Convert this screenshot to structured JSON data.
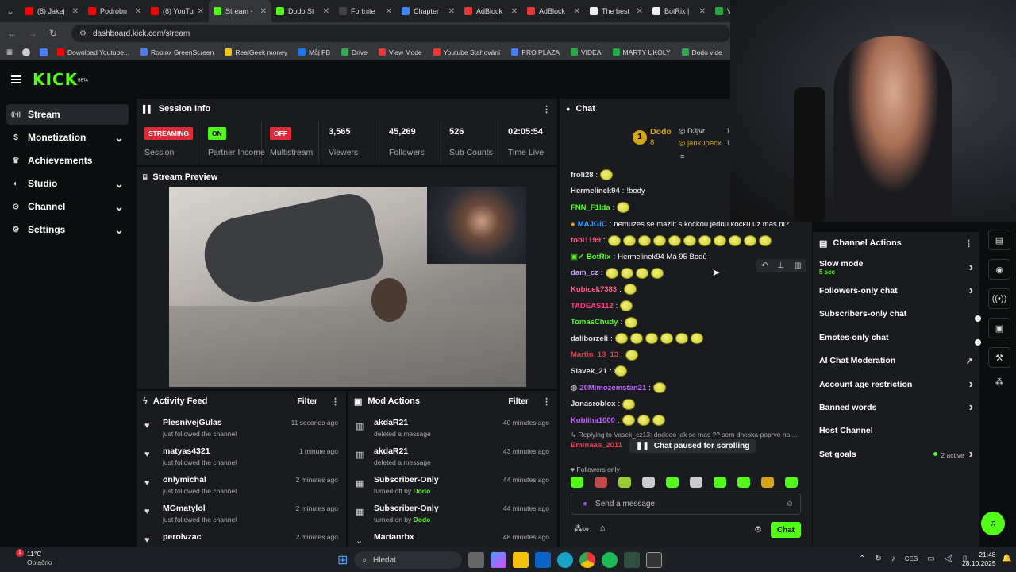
{
  "browser": {
    "tabs": [
      {
        "title": "(8) Jakej",
        "color": "#ff0000",
        "active": false
      },
      {
        "title": "Podrobn",
        "color": "#ff0000",
        "active": false
      },
      {
        "title": "(6) YouTu",
        "color": "#ff0000",
        "active": false
      },
      {
        "title": "Stream -",
        "color": "#53fc18",
        "active": true
      },
      {
        "title": "Dodo St",
        "color": "#53fc18",
        "active": false
      },
      {
        "title": "Fortnite",
        "color": "#444444",
        "active": false
      },
      {
        "title": "Chapter",
        "color": "#4285f4",
        "active": false
      },
      {
        "title": "AdBlock",
        "color": "#e53935",
        "active": false
      },
      {
        "title": "AdBlock",
        "color": "#e53935",
        "active": false
      },
      {
        "title": "The best",
        "color": "#eeeeee",
        "active": false
      },
      {
        "title": "BotRix |",
        "color": "#eeeeee",
        "active": false
      },
      {
        "title": "V",
        "color": "#22aa44",
        "active": false
      }
    ],
    "url": "dashboard.kick.com/stream",
    "bookmarks": [
      {
        "label": "Download Youtube...",
        "color": "#ff0000"
      },
      {
        "label": "Roblox GreenScreen",
        "color": "#4a7cf7"
      },
      {
        "label": "RealGeek money",
        "color": "#f4c20d"
      },
      {
        "label": "Můj FB",
        "color": "#1877f2"
      },
      {
        "label": "Drive",
        "color": "#34a853"
      },
      {
        "label": "View Mode",
        "color": "#e53935"
      },
      {
        "label": "Youtube Stahování",
        "color": "#e53935"
      },
      {
        "label": "PRO PLAZA",
        "color": "#4a7cf7"
      },
      {
        "label": "VIDEA",
        "color": "#22aa44"
      },
      {
        "label": "MARTY UKOLY",
        "color": "#22aa44"
      },
      {
        "label": "Dodo vide",
        "color": "#34a853"
      }
    ]
  },
  "kick": {
    "logo": "KICK",
    "logo_sup": "BETA",
    "sidebar": [
      {
        "label": "Stream",
        "icon": "stream-icon",
        "active": true,
        "chevron": false
      },
      {
        "label": "Monetization",
        "icon": "dollar-icon",
        "active": false,
        "chevron": true
      },
      {
        "label": "Achievements",
        "icon": "trophy-icon",
        "active": false,
        "chevron": false
      },
      {
        "label": "Studio",
        "icon": "studio-icon",
        "active": false,
        "chevron": true
      },
      {
        "label": "Channel",
        "icon": "channel-icon",
        "active": false,
        "chevron": true
      },
      {
        "label": "Settings",
        "icon": "gear-icon",
        "active": false,
        "chevron": true
      }
    ],
    "session": {
      "title": "Session Info",
      "streaming": {
        "badge": "STREAMING",
        "label": "Session"
      },
      "partner": {
        "badge": "ON",
        "label": "Partner Income"
      },
      "multistream": {
        "badge": "OFF",
        "label": "Multistream"
      },
      "viewers": {
        "value": "3,565",
        "label": "Viewers"
      },
      "followers": {
        "value": "45,269",
        "label": "Followers"
      },
      "subs": {
        "value": "526",
        "label": "Sub Counts"
      },
      "time": {
        "value": "02:05:54",
        "label": "Time Live"
      }
    },
    "preview_title": "Stream Preview",
    "activity": {
      "title": "Activity Feed",
      "filter": "Filter",
      "rows": [
        {
          "name": "PlesnivejGulas",
          "sub": "just followed the channel",
          "time": "11 seconds ago"
        },
        {
          "name": "matyas4321",
          "sub": "just followed the channel",
          "time": "1 minute ago"
        },
        {
          "name": "onlymichal",
          "sub": "just followed the channel",
          "time": "2 minutes ago"
        },
        {
          "name": "MGmatylol",
          "sub": "just followed the channel",
          "time": "2 minutes ago"
        },
        {
          "name": "perolvzac",
          "sub": "",
          "time": "2 minutes ago"
        }
      ]
    },
    "mod": {
      "title": "Mod Actions",
      "filter": "Filter",
      "rows": [
        {
          "name": "akdaR21",
          "sub": "deleted a message",
          "by": "",
          "time": "40 minutes ago",
          "icon": "trash-icon"
        },
        {
          "name": "akdaR21",
          "sub": "deleted a message",
          "by": "",
          "time": "43 minutes ago",
          "icon": "trash-icon"
        },
        {
          "name": "Subscriber-Only",
          "sub": "turned off by ",
          "by": "Dodo",
          "time": "44 minutes ago",
          "icon": "gift-icon"
        },
        {
          "name": "Subscriber-Only",
          "sub": "turned on by ",
          "by": "Dodo",
          "time": "44 minutes ago",
          "icon": "gift-icon"
        },
        {
          "name": "Martanrbx",
          "sub": "",
          "by": "",
          "time": "48 minutes ago",
          "icon": "chevron-down-icon"
        }
      ]
    },
    "chat": {
      "title": "Chat",
      "pinned": {
        "rank": "1",
        "name": "Dodo",
        "count": "8",
        "u1": "D3jvr",
        "u2": "jankupecx",
        "n1": "1",
        "n2": "1"
      },
      "messages": [
        {
          "user": "froli28",
          "color": "#e0e0e0",
          "text": "",
          "emotes": 1
        },
        {
          "user": "Hermelinek94",
          "color": "#e0e0e0",
          "text": "!body",
          "emotes": 0
        },
        {
          "user": "FNN_F1lda",
          "color": "#53fc18",
          "text": "",
          "emotes": 1
        },
        {
          "user": "MAJGIC",
          "color": "#4a9cff",
          "text": "nemuzes se mazlit s kockou jednu kocku uz mas ni?",
          "emotes": 0
        },
        {
          "user": "tobi1199",
          "color": "#ff5c8a",
          "text": "",
          "emotes": 11
        },
        {
          "user": "BotRix",
          "color": "#53fc18",
          "text": "Hermelinek94 Má 95 Bodů",
          "emotes": 0
        },
        {
          "user": "dam_cz",
          "color": "#c8a7ff",
          "text": "",
          "emotes": 4
        },
        {
          "user": "Kubicek7383",
          "color": "#ff5c8a",
          "text": "",
          "emotes": 1
        },
        {
          "user": "TADEAS112",
          "color": "#ff3c7a",
          "text": "",
          "emotes": 1
        },
        {
          "user": "TomasChudy",
          "color": "#53fc18",
          "text": "",
          "emotes": 1
        },
        {
          "user": "daliborzeli",
          "color": "#e0e0e0",
          "text": "",
          "emotes": 6
        },
        {
          "user": "Martin_13_13",
          "color": "#e0404a",
          "text": "",
          "emotes": 1
        },
        {
          "user": "Slavek_21",
          "color": "#e0e0e0",
          "text": "",
          "emotes": 1
        },
        {
          "user": "20Mimozemstan21",
          "color": "#c060ff",
          "text": "",
          "emotes": 1
        },
        {
          "user": "Jonasroblox",
          "color": "#e0e0e0",
          "text": "",
          "emotes": 1
        },
        {
          "user": "Kobliha1000",
          "color": "#c060ff",
          "text": "",
          "emotes": 3
        }
      ],
      "reply_text": "Replying to Vasek_cz13: dodooo jak se mas ?? sem dneska poprvé na ...",
      "reply_user": "Eminaaa_2011",
      "paused": "Chat paused for scrolling",
      "followers_only": "Followers only",
      "input_placeholder": "Send a message",
      "send_label": "Chat"
    },
    "channel_actions": {
      "title": "Channel Actions",
      "rows": [
        {
          "label": "Slow mode",
          "sub": "5 sec",
          "right": "chevron"
        },
        {
          "label": "Followers-only chat",
          "sub": "",
          "right": "chevron"
        },
        {
          "label": "Subscribers-only chat",
          "sub": "",
          "right": "toggle"
        },
        {
          "label": "Emotes-only chat",
          "sub": "",
          "right": "toggle"
        },
        {
          "label": "AI Chat Moderation",
          "sub": "",
          "right": "external"
        },
        {
          "label": "Account age restriction",
          "sub": "",
          "right": "chevron"
        },
        {
          "label": "Banned words",
          "sub": "",
          "right": "chevron"
        },
        {
          "label": "Host Channel",
          "sub": "",
          "right": ""
        },
        {
          "label": "Set goals",
          "sub": "2 active",
          "right": "chevron"
        }
      ]
    }
  },
  "taskbar": {
    "weather_temp": "11°C",
    "weather_desc": "Oblačno",
    "weather_badge": "1",
    "search_placeholder": "Hledat",
    "lang": "CES",
    "time": "21:48",
    "date": "28.10.2025"
  },
  "colors": {
    "accent": "#53fc18",
    "bg": "#0b0e0f",
    "panel": "#191b1f"
  }
}
